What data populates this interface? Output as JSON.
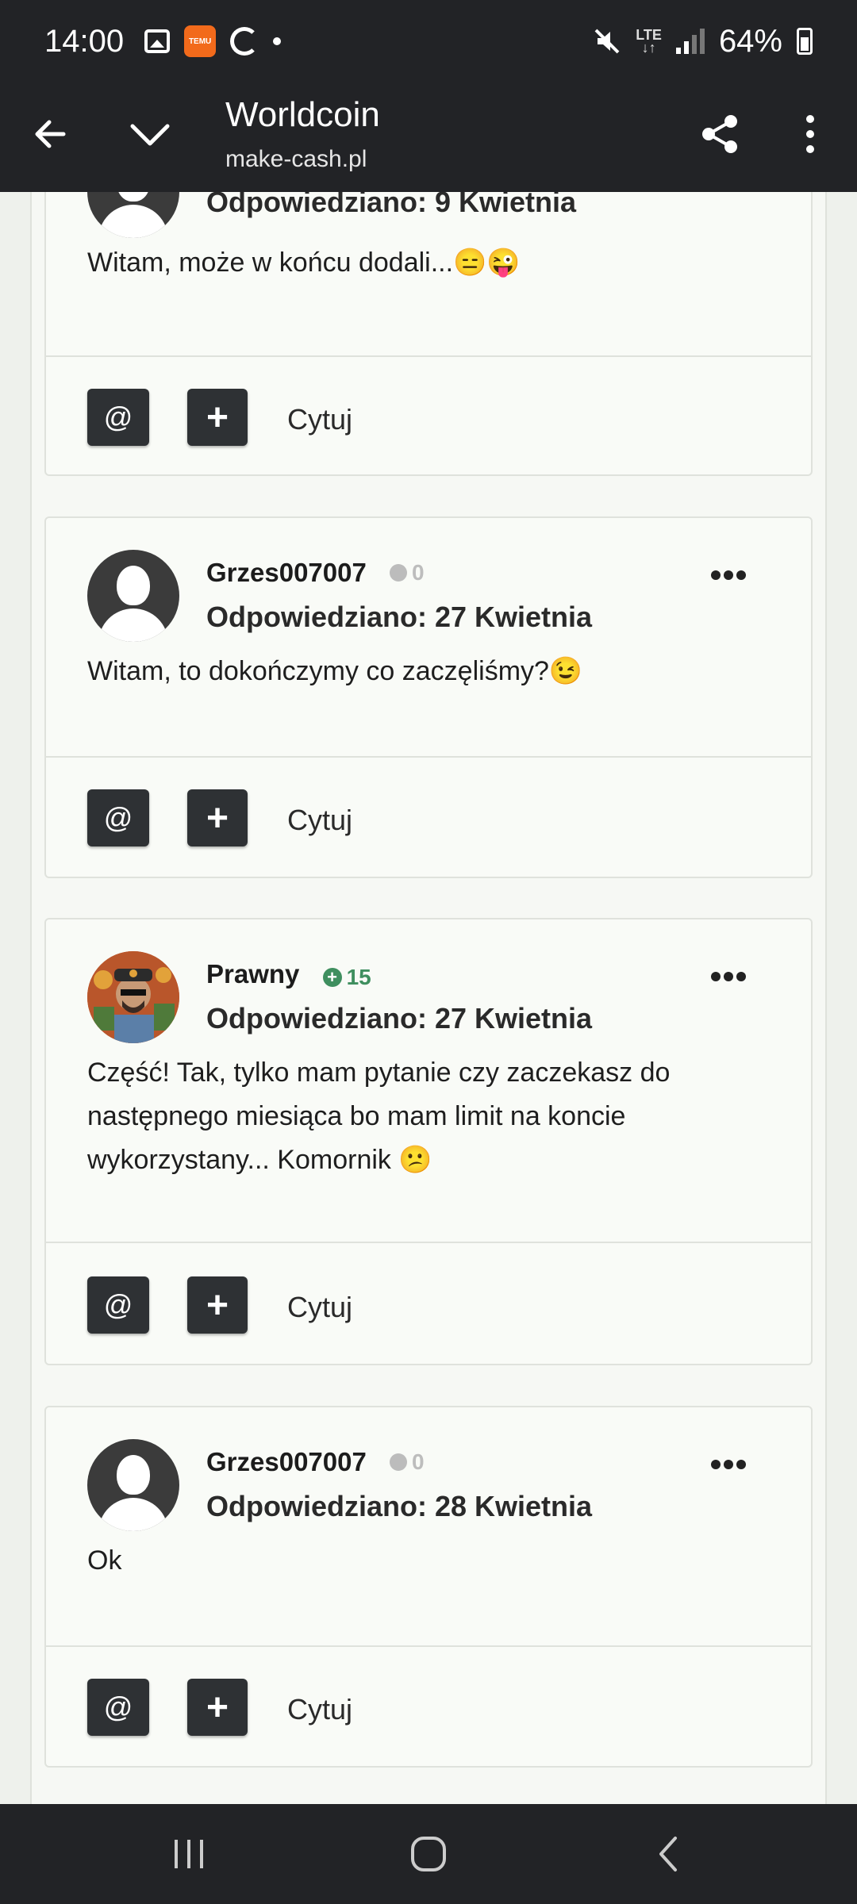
{
  "status_bar": {
    "time": "14:00",
    "temu_label": "TEMU",
    "network": "LTE",
    "battery": "64%"
  },
  "app_bar": {
    "title": "Worldcoin",
    "url": "make-cash.pl"
  },
  "posts": [
    {
      "username": "",
      "reputation": "",
      "answered": "Odpowiedziano: 9 Kwietnia",
      "text": "Witam, może w końcu dodali...😑😜",
      "avatar": "default-avatar-icon"
    },
    {
      "username": "Grzes007007",
      "reputation": "0",
      "answered": "Odpowiedziano: 27 Kwietnia",
      "text": "Witam, to dokończymy co zaczęliśmy?😉",
      "avatar": "default-avatar-icon"
    },
    {
      "username": "Prawny",
      "reputation": "15",
      "answered": "Odpowiedziano: 27 Kwietnia",
      "text": "Część! Tak, tylko mam pytanie czy zaczekasz do następnego miesiąca bo mam limit na koncie wykorzystany... Komornik 😕",
      "avatar": "bitcoin-man-avatar"
    },
    {
      "username": "Grzes007007",
      "reputation": "0",
      "answered": "Odpowiedziano: 28 Kwietnia",
      "text": "Ok",
      "avatar": "default-avatar-icon"
    }
  ],
  "actions": {
    "mention": "@",
    "plus": "+",
    "quote": "Cytuj"
  },
  "colors": {
    "bars": "#222326",
    "page_bg": "#eef1ec",
    "card_bg": "#f9fbf7",
    "button_bg": "#2e3134",
    "positive_rep": "#3f8f5f"
  }
}
